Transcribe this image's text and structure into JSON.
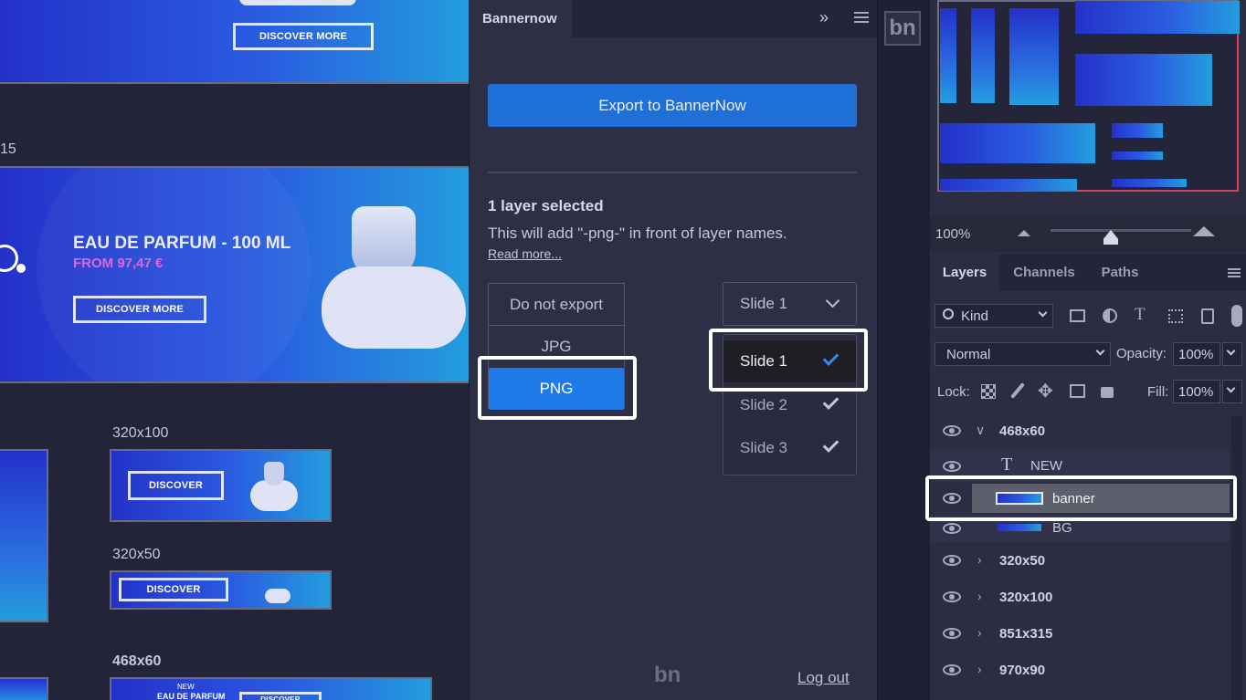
{
  "canvas": {
    "top_banner": {
      "button": "DISCOVER MORE"
    },
    "partial_label": "15",
    "large_banner": {
      "title": "EAU DE PARFUM - 100 ML",
      "price": "FROM 97,47 €",
      "button": "DISCOVER MORE"
    },
    "ads": [
      {
        "label": "320x100",
        "button": "DISCOVER"
      },
      {
        "label": "320x50",
        "button": "DISCOVER"
      },
      {
        "label": "468x60",
        "badge": "NEW",
        "title": "EAU DE PARFUM",
        "button": "DISCOVER"
      }
    ]
  },
  "panel": {
    "tab_title": "Bannernow",
    "export_button": "Export to BannerNow",
    "selection_heading": "1 layer selected",
    "selection_desc": "This will add \"-png-\" in front of layer names.",
    "read_more": "Read more...",
    "format_options": [
      "Do not export",
      "JPG",
      "PNG"
    ],
    "selected_format": "PNG",
    "slide_select_value": "Slide 1",
    "slide_options": [
      {
        "label": "Slide 1",
        "checked": true
      },
      {
        "label": "Slide 2",
        "checked": true
      },
      {
        "label": "Slide 3",
        "checked": true
      }
    ],
    "footer_logo": "bn",
    "logout": "Log out"
  },
  "toolstrip": {
    "logo": "bn"
  },
  "photoshop": {
    "zoom": "100%",
    "tabs": [
      "Layers",
      "Channels",
      "Paths"
    ],
    "active_tab": "Layers",
    "filter_kind": "Kind",
    "blend_mode": "Normal",
    "opacity_label": "Opacity:",
    "opacity_value": "100%",
    "lock_label": "Lock:",
    "fill_label": "Fill:",
    "fill_value": "100%",
    "layers": [
      {
        "name": "468x60",
        "type": "group",
        "expanded": true
      },
      {
        "name": "NEW",
        "type": "text"
      },
      {
        "name": "banner",
        "type": "image",
        "selected": true
      },
      {
        "name": "BG",
        "type": "image"
      },
      {
        "name": "320x50",
        "type": "group"
      },
      {
        "name": "320x100",
        "type": "group"
      },
      {
        "name": "851x315",
        "type": "group"
      },
      {
        "name": "970x90",
        "type": "group"
      }
    ]
  },
  "colors": {
    "accent_blue": "#1f6fd8",
    "canvas_bg": "#23233a",
    "panel_bg": "#2e2f44",
    "check_blue": "#2f8cf0",
    "highlight": "#ffffff"
  }
}
